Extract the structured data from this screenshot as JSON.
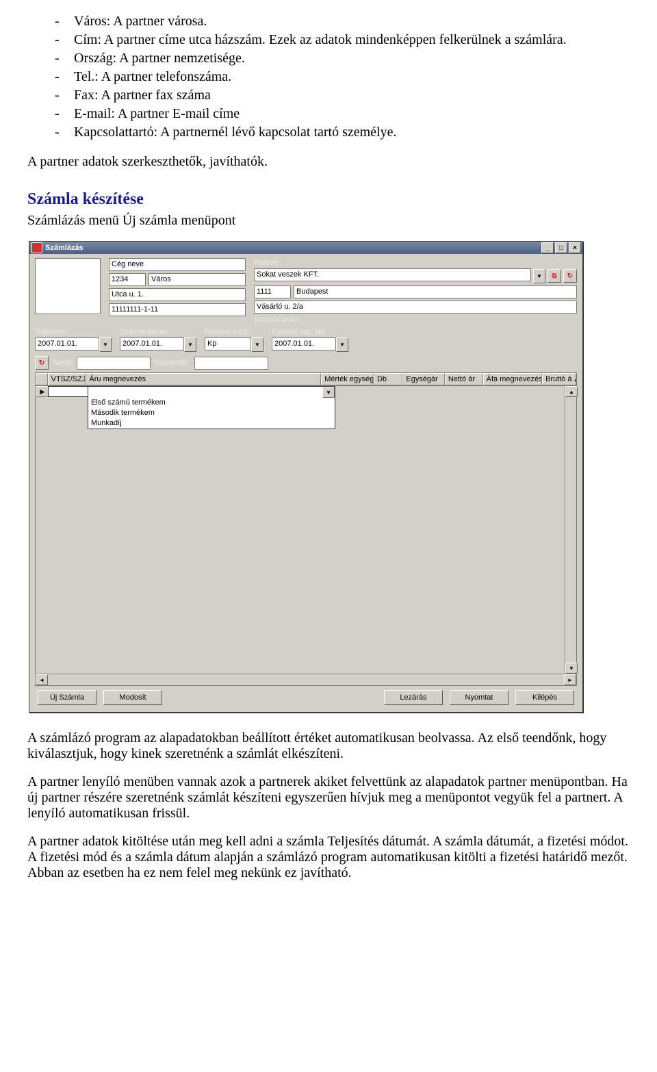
{
  "doc": {
    "bullets1": [
      "Város: A partner városa.",
      "Cím: A partner címe utca házszám. Ezek az adatok mindenképpen felkerülnek a számlára.",
      "Ország: A partner nemzetisége.",
      "Tel.: A partner telefonszáma.",
      "Fax: A partner fax száma",
      "E-mail: A partner E-mail címe",
      "Kapcsolattartó: A partnernél lévő kapcsolat tartó személye."
    ],
    "p_editable": "A partner adatok szerkeszthetők, javíthatók.",
    "h_szamla": "Számla készítése",
    "p_menupont": "Számlázás menü Új számla menüpont",
    "p_after1": "A számlázó program az alapadatokban beállított értéket automatikusan beolvassa. Az első teendőnk, hogy kiválasztjuk, hogy kinek szeretnénk a számlát elkészíteni.",
    "p_after2": "A partner lenyíló menüben vannak azok a partnerek akiket felvettünk az alapadatok partner menüpontban. Ha új partner részére szeretnénk számlát készíteni egyszerűen hívjuk meg a menüpontot vegyük fel a partnert. A lenyíló automatikusan frissül.",
    "p_after3": "A partner adatok kitöltése után meg kell adni a számla Teljesítés dátumát. A számla dátumát, a fizetési módot. A fizetési mód és a számla dátum alapján a számlázó program automatikusan kitölti a fizetési határidő mezőt. Abban az esetben ha ez nem felel meg nekünk ez javítható."
  },
  "win": {
    "title": "Számlázás",
    "company": {
      "name": "Cég neve",
      "zip": "1234",
      "city": "Város",
      "addr": "Utca u. 1.",
      "tax": "11111111-1-11"
    },
    "partner": {
      "label": "Partner:",
      "name": "Sokat veszek KFT.",
      "zip": "1111",
      "city": "Budapest",
      "addr": "Vásárló u. 2/a",
      "invoice_label": "Számla szám:"
    },
    "dates": {
      "telj_l": "Teljesítés:",
      "telj_v": "2007.01.01.",
      "szd_l": "Számla dátum:",
      "szd_v": "2007.01.01.",
      "mod_l": "Fizetési mód:",
      "mod_v": "Kp",
      "hat_l": "Fizetési hat. idő:",
      "hat_v": "2007.01.01."
    },
    "totals": {
      "netto_l": "Nettó:",
      "fiz_l": "Fizetendő:"
    },
    "grid": {
      "headers": [
        "VTSZ/SZJ",
        "Áru megnevezés",
        "Mérték egység",
        "Db",
        "Egységár",
        "Nettó ár",
        "Áfa megnevezés",
        "Bruttó á"
      ],
      "dropdown": [
        "Első számú termékem",
        "Második termékem",
        "Munkadíj"
      ]
    },
    "buttons": {
      "uj": "Új Számla",
      "mod": "Modosít",
      "lez": "Lezárás",
      "ny": "Nyomtat",
      "kil": "Kilépés"
    }
  }
}
